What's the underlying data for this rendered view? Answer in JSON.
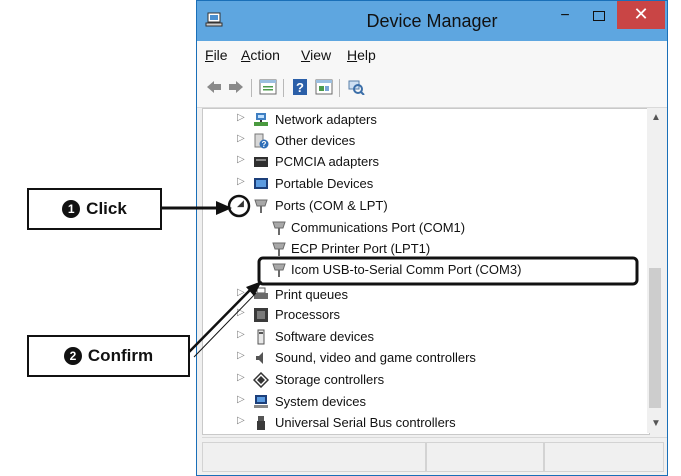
{
  "window": {
    "title": "Device Manager",
    "min_glyph": "−",
    "close_glyph": "✕"
  },
  "menu": {
    "file": "File",
    "action": "Action",
    "view": "View",
    "help": "Help"
  },
  "toolbar": {
    "icons": [
      "back-arrow-icon",
      "forward-arrow-icon",
      "properties-icon",
      "help-icon",
      "driver-icon",
      "scan-hardware-icon"
    ]
  },
  "tree": {
    "items": [
      {
        "label": "Network adapters",
        "icon": "network-adapter-icon"
      },
      {
        "label": "Other devices",
        "icon": "unknown-device-icon"
      },
      {
        "label": "PCMCIA adapters",
        "icon": "pcmcia-icon"
      },
      {
        "label": "Portable Devices",
        "icon": "portable-device-icon"
      },
      {
        "label": "Ports (COM & LPT)",
        "icon": "port-icon",
        "expanded": true
      },
      {
        "label": "Communications Port (COM1)",
        "icon": "port-icon",
        "child": true
      },
      {
        "label": "ECP Printer Port (LPT1)",
        "icon": "port-icon",
        "child": true
      },
      {
        "label": "Icom USB-to-Serial Comm Port (COM3)",
        "icon": "port-icon",
        "child": true
      },
      {
        "label": "Print queues",
        "icon": "printer-icon"
      },
      {
        "label": "Processors",
        "icon": "processor-icon"
      },
      {
        "label": "Software devices",
        "icon": "software-device-icon"
      },
      {
        "label": "Sound, video and game controllers",
        "icon": "speaker-icon"
      },
      {
        "label": "Storage controllers",
        "icon": "storage-icon"
      },
      {
        "label": "System devices",
        "icon": "system-device-icon"
      },
      {
        "label": "Universal Serial Bus controllers",
        "icon": "usb-icon"
      }
    ]
  },
  "callouts": {
    "click_num": "1",
    "click_label": "Click",
    "confirm_num": "2",
    "confirm_label": "Confirm"
  },
  "colors": {
    "titlebar": "#5ea6e0",
    "close_button": "#c94545",
    "callout_border": "#111111"
  }
}
